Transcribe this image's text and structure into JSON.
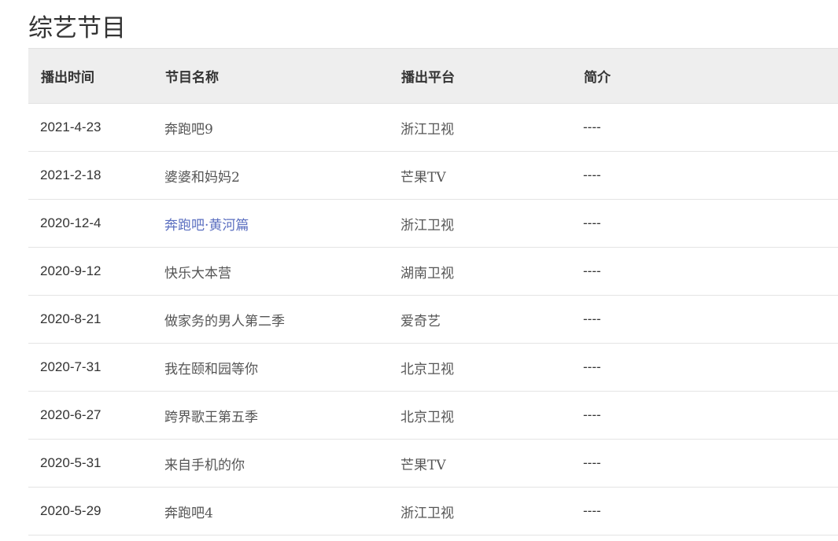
{
  "page": {
    "title": "综艺节目"
  },
  "table": {
    "headers": [
      "播出时间",
      "节目名称",
      "播出平台",
      "简介"
    ],
    "rows": [
      {
        "date": "2021-4-23",
        "name": "奔跑吧9",
        "platform": "浙江卫视",
        "intro": "----",
        "link": false
      },
      {
        "date": "2021-2-18",
        "name": "婆婆和妈妈2",
        "platform": "芒果TV",
        "intro": "----",
        "link": false
      },
      {
        "date": "2020-12-4",
        "name": "奔跑吧·黄河篇",
        "platform": "浙江卫视",
        "intro": "----",
        "link": true
      },
      {
        "date": "2020-9-12",
        "name": "快乐大本营",
        "platform": "湖南卫视",
        "intro": "----",
        "link": false
      },
      {
        "date": "2020-8-21",
        "name": "做家务的男人第二季",
        "platform": "爱奇艺",
        "intro": "----",
        "link": false
      },
      {
        "date": "2020-7-31",
        "name": "我在颐和园等你",
        "platform": "北京卫视",
        "intro": "----",
        "link": false
      },
      {
        "date": "2020-6-27",
        "name": "跨界歌王第五季",
        "platform": "北京卫视",
        "intro": "----",
        "link": false
      },
      {
        "date": "2020-5-31",
        "name": "来自手机的你",
        "platform": "芒果TV",
        "intro": "----",
        "link": false
      },
      {
        "date": "2020-5-29",
        "name": "奔跑吧4",
        "platform": "浙江卫视",
        "intro": "----",
        "link": false
      }
    ]
  },
  "colors": {
    "link": "#5b6fc0",
    "header_bg": "#eeeeee",
    "text": "#333333"
  }
}
